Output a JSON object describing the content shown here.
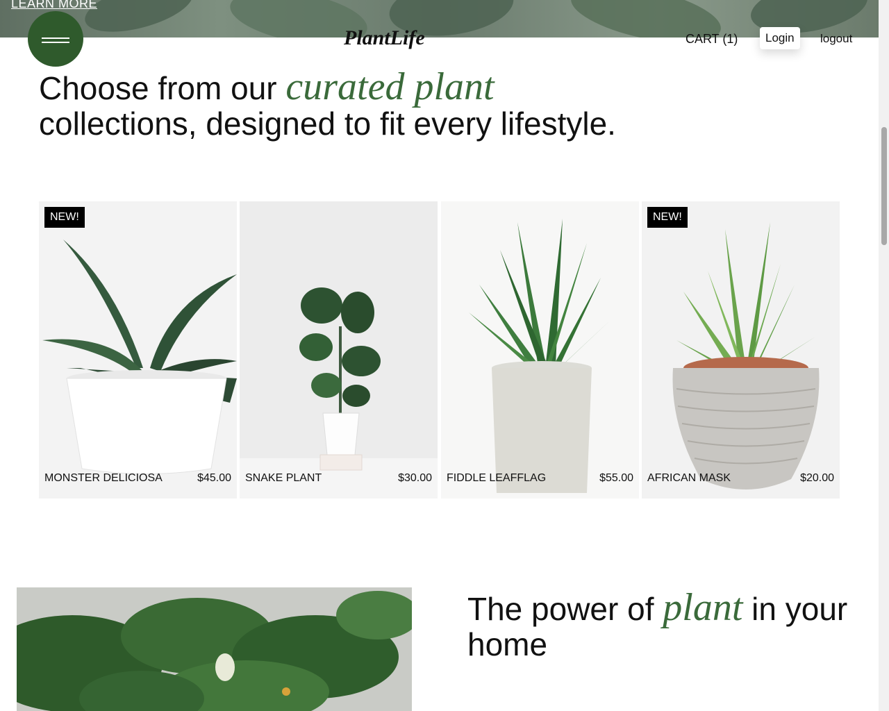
{
  "hero": {
    "learn_more": "LEARN MORE"
  },
  "header": {
    "brand": "PlantLife",
    "cart": "CART (1)",
    "login": "Login",
    "logout": "logout"
  },
  "intro": {
    "text_before": "Choose from our ",
    "accent": "curated plant",
    "text_after": "collections, designed to fit every lifestyle."
  },
  "products": [
    {
      "name": "MONSTER DELICIOSA",
      "price": "$45.00",
      "badge": "NEW!"
    },
    {
      "name": "SNAKE PLANT",
      "price": "$30.00",
      "badge": ""
    },
    {
      "name": "FIDDLE LEAFFLAG",
      "price": "$55.00",
      "badge": ""
    },
    {
      "name": "AFRICAN MASK",
      "price": "$20.00",
      "badge": "NEW!"
    }
  ],
  "feature": {
    "text_before": "The power of ",
    "accent": "plant",
    "text_after": " in your home"
  },
  "colors": {
    "accent": "#3a6a3a",
    "menu_button": "#2f5a2c",
    "badge_bg": "#000000"
  }
}
